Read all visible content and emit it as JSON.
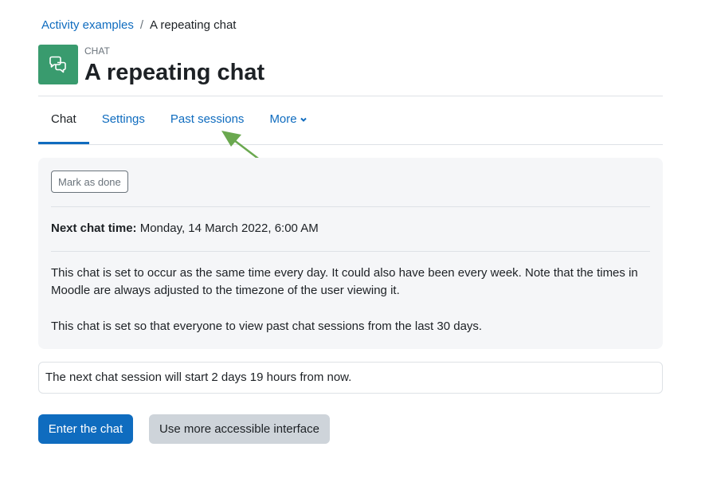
{
  "breadcrumb": {
    "parent": "Activity examples",
    "separator": "/",
    "current": "A repeating chat"
  },
  "header": {
    "modtype": "CHAT",
    "title": "A repeating chat",
    "icon": "chat-bubbles-icon",
    "icon_color": "#399b6e"
  },
  "tabs": [
    {
      "label": "Chat",
      "active": true
    },
    {
      "label": "Settings",
      "active": false
    },
    {
      "label": "Past sessions",
      "active": false
    },
    {
      "label": "More",
      "active": false,
      "icon": "chevron-down-icon"
    }
  ],
  "annotation": {
    "arrow_color": "#6aa84f",
    "icon": "arrow-annotation"
  },
  "panel": {
    "mark_done_label": "Mark as done",
    "next_chat_label": "Next chat time:",
    "next_chat_value": "Monday, 14 March 2022, 6:00 AM",
    "description": [
      "This chat is set to occur as the same time every day. It could also have been every week. Note that the times in Moodle are always adjusted to the timezone of the user viewing it.",
      "This chat is set so that everyone to view past chat sessions from the last 30 days."
    ]
  },
  "notice": {
    "text": "The next chat session will start 2 days 19 hours from now."
  },
  "actions": {
    "enter_label": "Enter the chat",
    "accessible_label": "Use more accessible interface"
  },
  "colors": {
    "link": "#0f6cbf",
    "primary": "#0f6cbf",
    "secondary": "#ced4da",
    "panel_bg": "#f5f6f8"
  }
}
